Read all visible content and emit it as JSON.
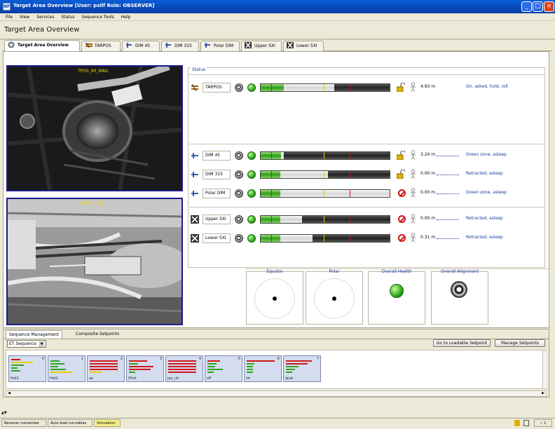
{
  "window": {
    "title": "Target Area Overview  [User: psilf  Role: OBSERVER]",
    "minimize": "_",
    "maximize": "□",
    "close": "×"
  },
  "menu": [
    "File",
    "View",
    "Services",
    "Status",
    "Sequence Tools",
    "Help"
  ],
  "page_title": "Target Area Overview",
  "tabs": [
    {
      "label": "Target Area Overview",
      "icon": "overview-icon",
      "active": true
    },
    {
      "label": "TARPOS",
      "icon": "tarpos-icon"
    },
    {
      "label": "DIM 45",
      "icon": "dim-icon"
    },
    {
      "label": "DIM 315",
      "icon": "dim-icon"
    },
    {
      "label": "Polar DIM",
      "icon": "dim-icon"
    },
    {
      "label": "Upper SXI",
      "icon": "sxi-icon"
    },
    {
      "label": "Lower SXI",
      "icon": "sxi-icon"
    }
  ],
  "cameras": {
    "top": "TPOS_90_MAG",
    "bottom": "DIM5 7_225"
  },
  "status": {
    "title": "Status",
    "rows": [
      {
        "name": "TARPOS",
        "progress": 0.57,
        "green": 0.18,
        "distance": "4.93 m",
        "desc": "On, asked, hold, roll",
        "lock": "lock",
        "key": "tarpos"
      },
      {
        "name": "DIM 45",
        "progress": 0.18,
        "green": 0.16,
        "distance": "3.24 m",
        "desc": "Green zone, asleep",
        "lock": "lock",
        "key": "dim45"
      },
      {
        "name": "DIM 315",
        "progress": 0.52,
        "green": 0.15,
        "distance": "0.00 m",
        "desc": "Retracted, asleep",
        "lock": "lock",
        "key": "dim315"
      },
      {
        "name": "Polar DIM",
        "progress": 1.0,
        "green": 0.15,
        "distance": "0.00 m",
        "desc": "Green zone, asleep",
        "lock": "block",
        "key": "polar"
      },
      {
        "name": "Upper SXI",
        "progress": 0.32,
        "green": 0.15,
        "distance": "0.00 m",
        "desc": "Retracted, asleep",
        "lock": "block",
        "key": "upper"
      },
      {
        "name": "Lower SXI",
        "progress": 0.4,
        "green": 0.15,
        "distance": "0.31 m",
        "desc": "Retracted, asleep",
        "lock": "block",
        "key": "lower"
      }
    ]
  },
  "gauges": {
    "equator": "Equator",
    "polar": "Polar",
    "health": "Overall Health",
    "alignment": "Overall Alignment"
  },
  "sequence": {
    "tabs": [
      "Sequence Management",
      "Composite Setpoints"
    ],
    "select_value": "ET Sequence",
    "button_load": "Go to Loadable Setpoint",
    "button_manage": "Manage Setpoints",
    "thumbs": [
      {
        "label": "Hot1",
        "num": "0"
      },
      {
        "label": "Hot2",
        "num": "1"
      },
      {
        "label": "ay",
        "num": "2"
      },
      {
        "label": "Xhot",
        "num": "3"
      },
      {
        "label": "jay_uh",
        "num": "4"
      },
      {
        "label": "ofl",
        "num": "5"
      },
      {
        "label": "im",
        "num": "6"
      },
      {
        "label": "quat",
        "num": "7"
      }
    ]
  },
  "statusbar": [
    "Receiver connected",
    "Auto-load run-tables",
    "Simulation"
  ],
  "colors": {
    "accent": "#0a3fa6",
    "ok": "#2ea51c",
    "warn": "#d01818",
    "sim": "#f6f082"
  }
}
